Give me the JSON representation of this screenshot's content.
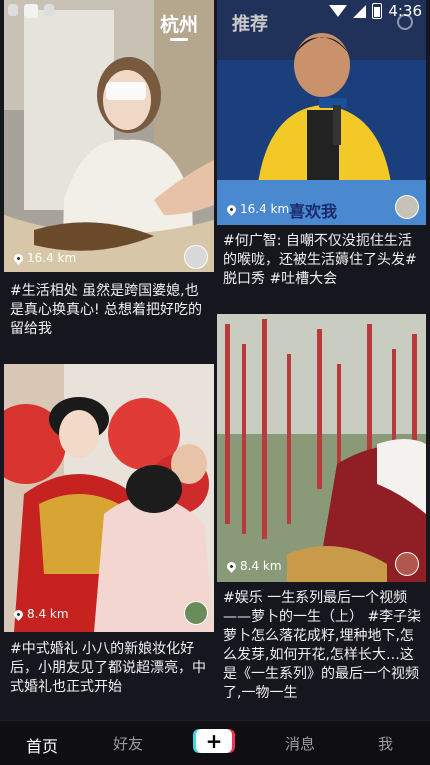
{
  "status_bar": {
    "time": "4:36"
  },
  "top_nav": {
    "city": "杭州",
    "recommend": "推荐"
  },
  "cards": [
    {
      "distance": "16.4 km",
      "caption": "#生活相处 虽然是跨国婆媳,也是真心换真心! 总想着把好吃的留给我"
    },
    {
      "distance": "16.4 km",
      "caption": "#何广智: 自嘲不仅没扼住生活的喉咙，还被生活薅住了头发#脱口秀 #吐槽大会",
      "overlay_text": "喜欢我"
    },
    {
      "distance": "8.4 km",
      "caption": "#中式婚礼 小八的新娘妆化好后，小朋友见了都说超漂亮，中式婚礼也正式开始"
    },
    {
      "distance": "8.4 km",
      "caption": "#娱乐 一生系列最后一个视频——萝卜的一生（上） #李子柒 萝卜怎么落花成籽,埋种地下,怎么发芽,如何开花,怎样长大…这是《一生系列》的最后一个视频了,一物一生"
    }
  ],
  "bottom_nav": {
    "home": "首页",
    "friends": "好友",
    "plus": "+",
    "messages": "消息",
    "me": "我"
  }
}
